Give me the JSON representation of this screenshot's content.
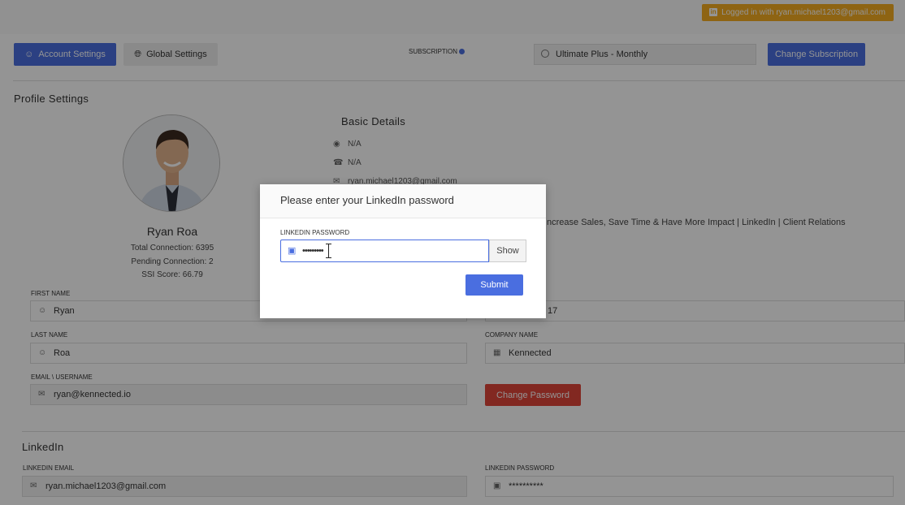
{
  "topbar": {
    "login_badge": "Logged in with ryan.michael1203@gmail.com"
  },
  "tabs": {
    "account": "Account Settings",
    "global": "Global Settings"
  },
  "subscription": {
    "label": "SUBSCRIPTION",
    "plan": "Ultimate Plus - Monthly",
    "change_label": "Change Subscription"
  },
  "profile": {
    "section_title": "Profile Settings",
    "name": "Ryan Roa",
    "total_connection": "Total Connection: 6395",
    "pending_connection": "Pending Connection: 2",
    "ssi_score": "SSI Score: 66.79"
  },
  "basic": {
    "title": "Basic Details",
    "location": "N/A",
    "phone": "N/A",
    "email": "ryan.michael1203@gmail.com",
    "headline": "ncrease Sales, Save Time & Have More Impact | LinkedIn | Client Relations"
  },
  "form": {
    "first_name_label": "FIRST NAME",
    "first_name": "Ryan",
    "phone_partial": "17",
    "last_name_label": "LAST NAME",
    "last_name": "Roa",
    "company_label": "COMPANY NAME",
    "company": "Kennected",
    "email_label": "EMAIL \\ USERNAME",
    "email": "ryan@kennected.io",
    "change_password": "Change Password"
  },
  "linkedin": {
    "section_title": "LinkedIn",
    "email_label": "LINKEDIN EMAIL",
    "email": "ryan.michael1203@gmail.com",
    "password_label": "LINKEDIN PASSWORD",
    "password": "**********"
  },
  "modal": {
    "title": "Please enter your LinkedIn password",
    "label": "LINKEDIN PASSWORD",
    "value": "•••••••••",
    "show": "Show",
    "submit": "Submit"
  }
}
